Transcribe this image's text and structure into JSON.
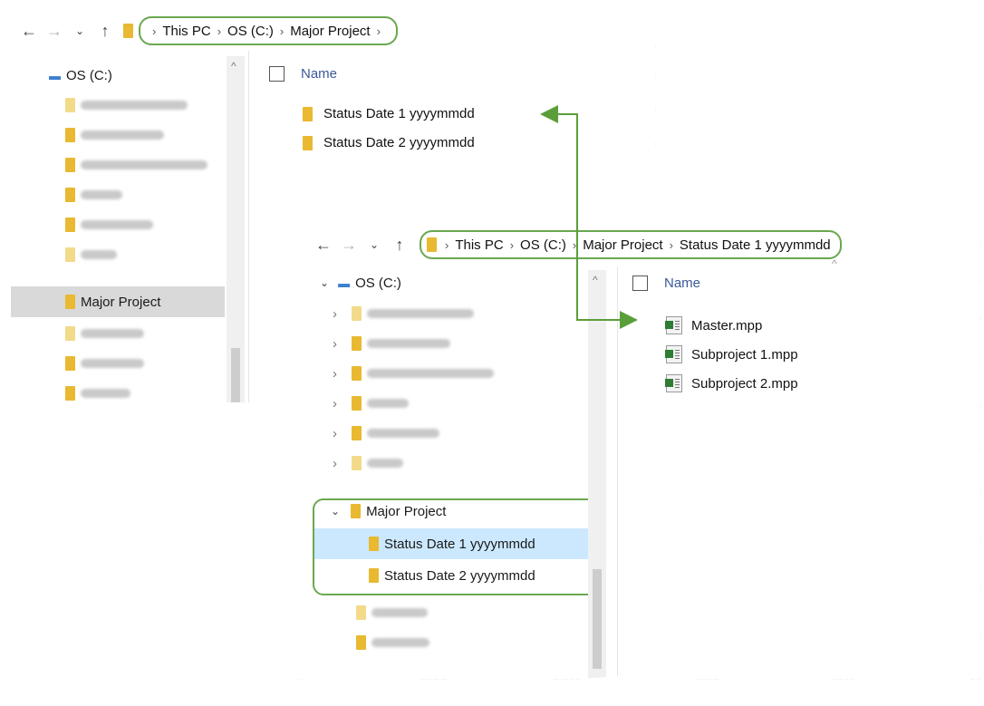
{
  "window_back": {
    "breadcrumb": [
      "This PC",
      "OS (C:)",
      "Major Project"
    ],
    "nav_drive": "OS (C:)",
    "nav_selected": "Major Project",
    "column_header": "Name",
    "folders": [
      "Status Date 1 yyyymmdd",
      "Status Date 2 yyyymmdd"
    ]
  },
  "window_front": {
    "breadcrumb": [
      "This PC",
      "OS (C:)",
      "Major Project",
      "Status Date 1 yyyymmdd"
    ],
    "nav_drive": "OS (C:)",
    "nav_project": "Major Project",
    "nav_subfolders": [
      "Status Date 1 yyyymmdd",
      "Status Date 2 yyyymmdd"
    ],
    "column_header": "Name",
    "files": [
      "Master.mpp",
      "Subproject 1.mpp",
      "Subproject 2.mpp"
    ]
  },
  "icons": {
    "back": "back-arrow-icon",
    "forward": "forward-arrow-icon",
    "recent": "chevron-down-icon",
    "up": "up-arrow-icon",
    "folder": "folder-icon",
    "drive": "drive-icon",
    "mpp": "project-file-icon"
  },
  "colors": {
    "highlight_outline": "#6aa84f",
    "connector_arrow": "#5a9e3a",
    "selected_item": "#cce8ff",
    "folder": "#e8b931"
  }
}
